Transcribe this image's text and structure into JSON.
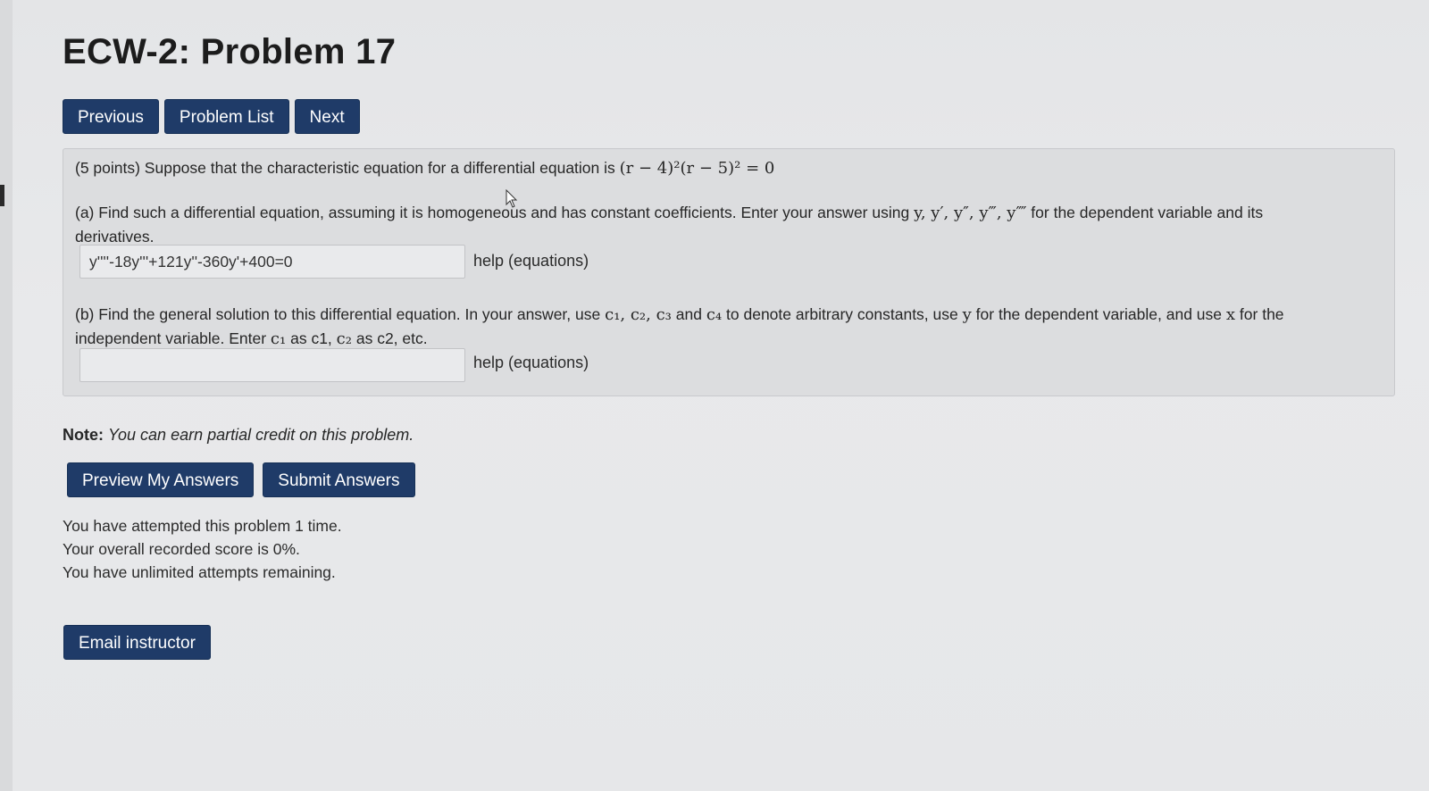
{
  "page_title": "ECW-2: Problem 17",
  "nav": {
    "previous": "Previous",
    "problem_list": "Problem List",
    "next": "Next"
  },
  "problem": {
    "intro_text": "(5 points) Suppose that the characteristic equation for a differential equation is",
    "intro_math": "(r − 4)²(r − 5)² = 0",
    "part_a": {
      "text_1": "(a) Find such a differential equation, assuming it is homogeneous and has constant coefficients. Enter your answer using",
      "math": "y, y′, y″, y‴, y⁗",
      "text_2": "for the dependent variable and its derivatives.",
      "answer_value": "y''''-18y'''+121y''-360y'+400=0",
      "help": "help (equations)"
    },
    "part_b": {
      "text_1": "(b) Find the general solution to this differential equation. In your answer, use",
      "constants_math": "c₁, c₂, c₃",
      "and_word": "and",
      "c4_math": "c₄",
      "text_2": "to denote arbitrary constants, use",
      "y_math": "y",
      "text_3": "for the dependent variable, and use",
      "x_math": "x",
      "text_4": "for the independent variable. Enter",
      "c1_math": "c₁",
      "as_c1": "as c1,",
      "c2_math": "c₂",
      "as_c2": "as c2, etc.",
      "answer_value": "",
      "help": "help (equations)"
    }
  },
  "note": {
    "label": "Note:",
    "text": "You can earn partial credit on this problem."
  },
  "actions": {
    "preview": "Preview My Answers",
    "submit": "Submit Answers"
  },
  "status": {
    "attempts": "You have attempted this problem 1 time.",
    "score": "Your overall recorded score is 0%.",
    "remaining": "You have unlimited attempts remaining."
  },
  "email_button": "Email instructor",
  "colors": {
    "button_bg": "#1f3b68",
    "page_bg": "#e6e7e9",
    "problem_box_bg": "#dcdddf"
  }
}
